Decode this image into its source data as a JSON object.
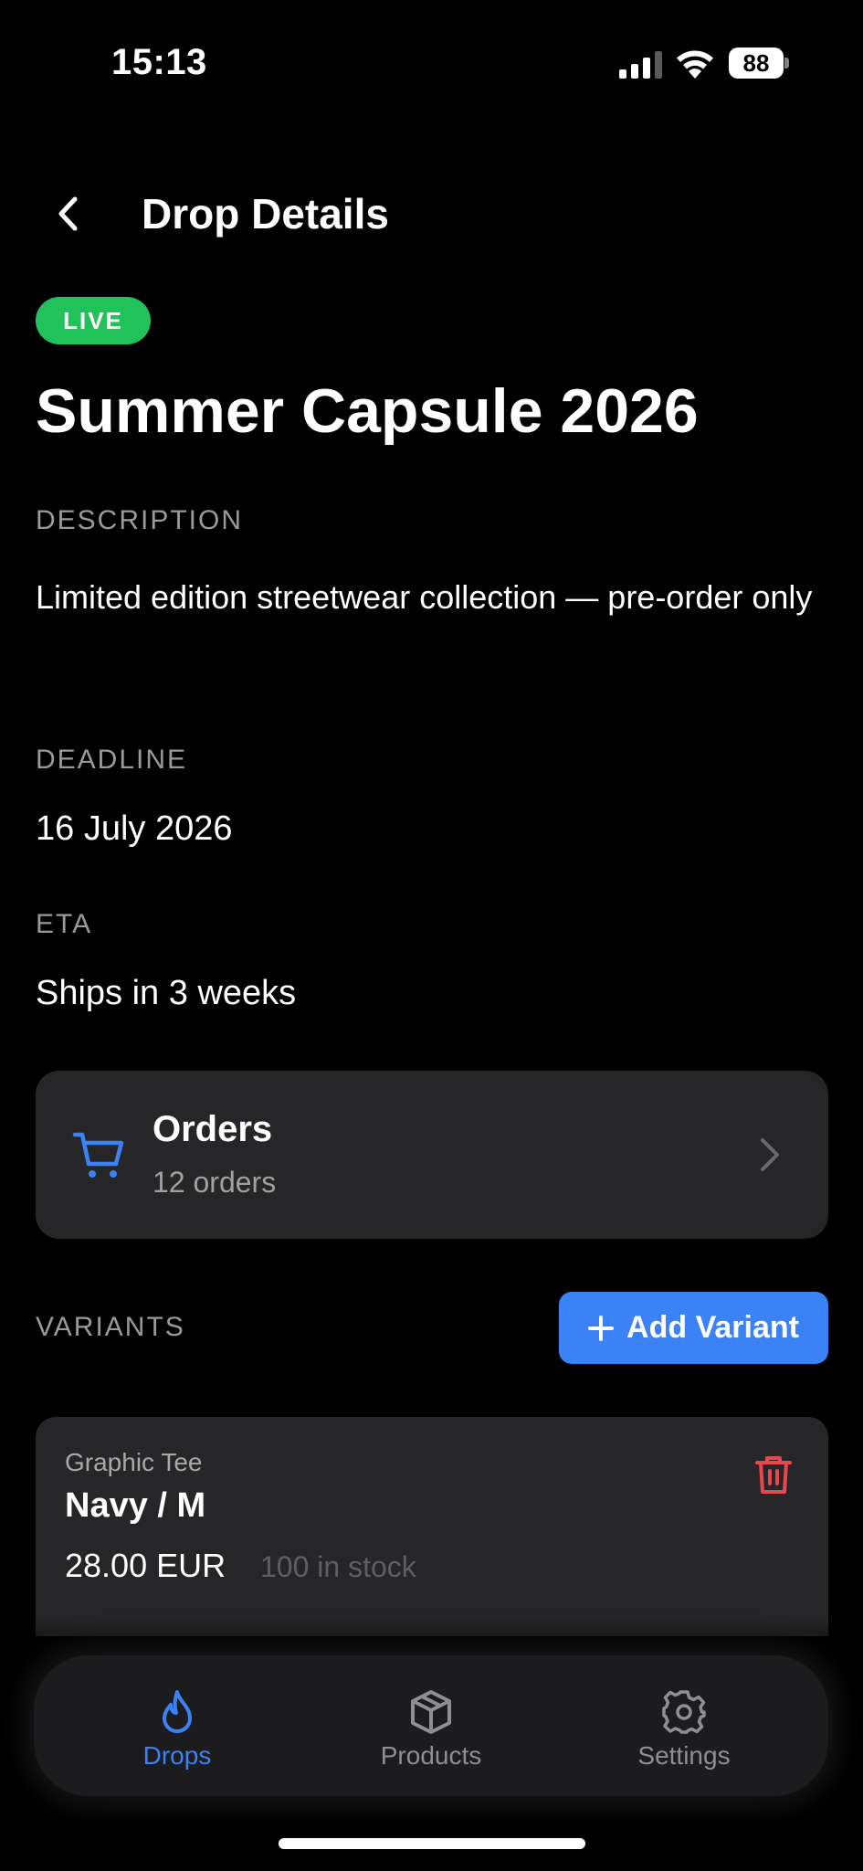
{
  "status_bar": {
    "time": "15:13",
    "battery": "88"
  },
  "header": {
    "title": "Drop Details"
  },
  "drop": {
    "status": "LIVE",
    "title": "Summer Capsule 2026",
    "description_label": "DESCRIPTION",
    "description": "Limited edition streetwear collection — pre-order only",
    "deadline_label": "DEADLINE",
    "deadline": "16 July 2026",
    "eta_label": "ETA",
    "eta": "Ships in 3 weeks"
  },
  "orders": {
    "title": "Orders",
    "subtitle": "12 orders"
  },
  "variants": {
    "label": "VARIANTS",
    "add_button_label": "Add Variant",
    "items": [
      {
        "product": "Graphic Tee",
        "name": "Navy / M",
        "price": "28.00 EUR",
        "stock": "100 in stock"
      }
    ]
  },
  "tabs": [
    {
      "label": "Drops",
      "icon": "flame-icon",
      "active": true
    },
    {
      "label": "Products",
      "icon": "box-icon",
      "active": false
    },
    {
      "label": "Settings",
      "icon": "gear-icon",
      "active": false
    }
  ],
  "colors": {
    "accent": "#3b82f6",
    "live": "#22c25a",
    "danger": "#e5484d",
    "card": "#262628"
  }
}
